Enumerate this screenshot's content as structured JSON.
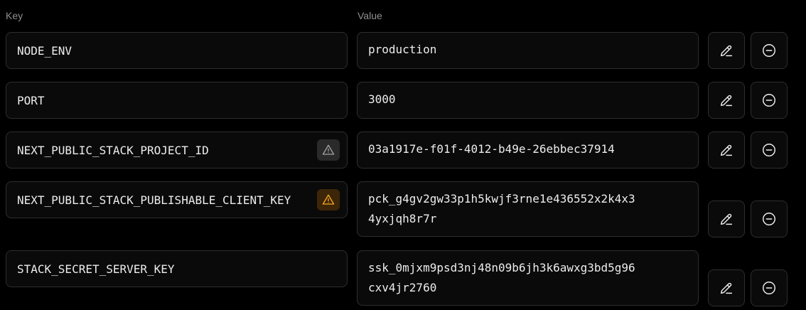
{
  "headers": {
    "key": "Key",
    "value": "Value"
  },
  "colors": {
    "warning_gray": "#a1a1a1",
    "warning_amber": "#f5a623"
  },
  "rows": [
    {
      "key": "NODE_ENV",
      "value": "production",
      "warning": "none"
    },
    {
      "key": "PORT",
      "value": "3000",
      "warning": "none"
    },
    {
      "key": "NEXT_PUBLIC_STACK_PROJECT_ID",
      "value": "03a1917e-f01f-4012-b49e-26ebbec37914",
      "warning": "gray-warning-icon"
    },
    {
      "key": "NEXT_PUBLIC_STACK_PUBLISHABLE_CLIENT_KEY",
      "value": "pck_g4gv2gw33p1h5kwjf3rne1e436552x2k4x3\n4yxjqh8r7r",
      "warning": "amber-warning-icon"
    },
    {
      "key": "STACK_SECRET_SERVER_KEY",
      "value": "ssk_0mjxm9psd3nj48n09b6jh3k6awxg3bd5g96\ncxv4jr2760",
      "warning": "none"
    }
  ]
}
